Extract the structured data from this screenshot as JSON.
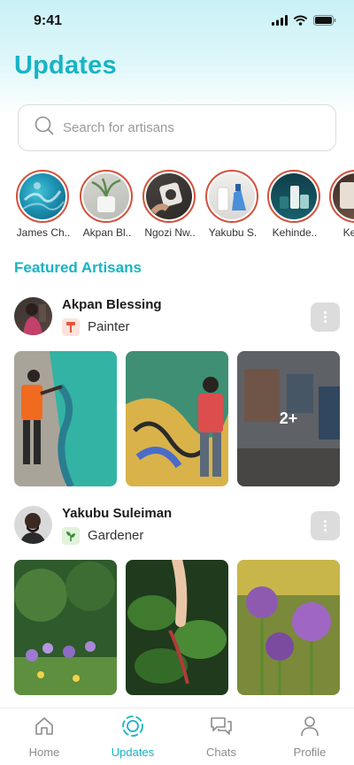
{
  "status_bar": {
    "time": "9:41"
  },
  "header": {
    "title": "Updates"
  },
  "search": {
    "placeholder": "Search for artisans"
  },
  "stories": [
    {
      "name": "James Ch.."
    },
    {
      "name": "Akpan Bl.."
    },
    {
      "name": "Ngozi Nw.."
    },
    {
      "name": "Yakubu S."
    },
    {
      "name": "Kehinde.."
    },
    {
      "name": "Kehin"
    }
  ],
  "featured": {
    "title": "Featured Artisans",
    "artisans": [
      {
        "name": "Akpan Blessing",
        "role": "Painter",
        "role_icon": "paint-roller-icon",
        "more_photos": "2+"
      },
      {
        "name": "Yakubu Suleiman",
        "role": "Gardener",
        "role_icon": "plant-icon"
      }
    ]
  },
  "tab_bar": {
    "tabs": [
      {
        "label": "Home",
        "icon": "home-icon"
      },
      {
        "label": "Updates",
        "icon": "updates-icon",
        "active": true
      },
      {
        "label": "Chats",
        "icon": "chats-icon"
      },
      {
        "label": "Profile",
        "icon": "profile-icon"
      }
    ]
  },
  "colors": {
    "accent": "#19b3c5",
    "story_ring": "#d2523d",
    "painter_icon_bg": "#fde3dc",
    "gardener_icon_bg": "#e2f2dc"
  }
}
